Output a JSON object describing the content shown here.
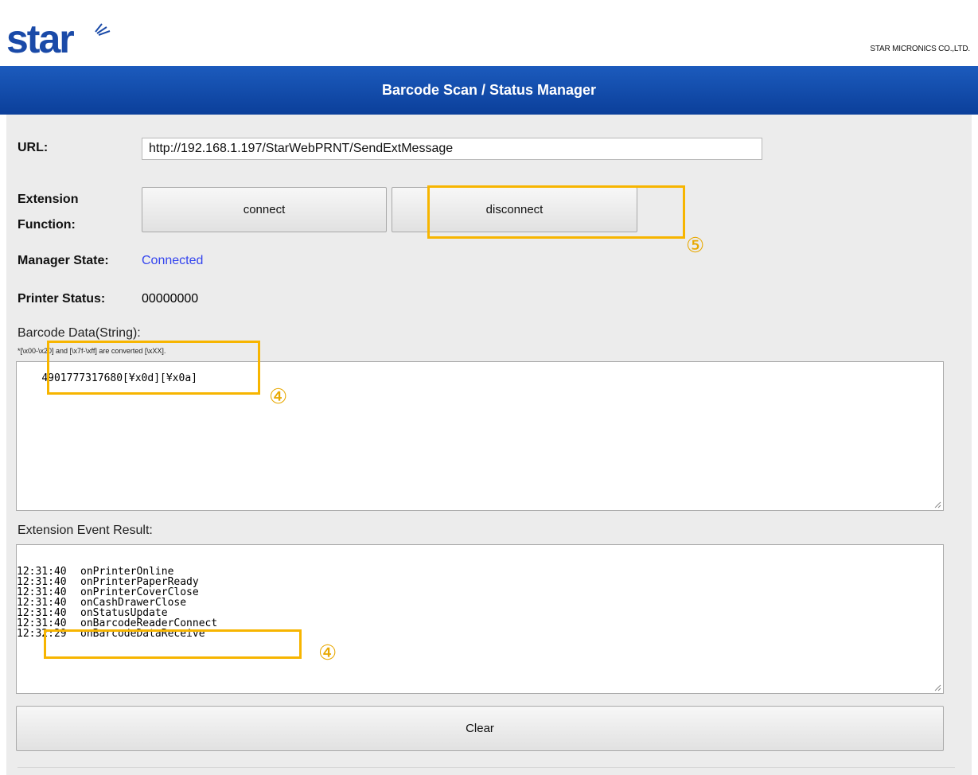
{
  "header": {
    "logo_alt": "star",
    "company": "STAR MICRONICS CO.,LTD."
  },
  "title": "Barcode Scan / Status Manager",
  "form": {
    "url_label": "URL:",
    "url_value": "http://192.168.1.197/StarWebPRNT/SendExtMessage",
    "extension_label_line1": "Extension",
    "extension_label_line2": "Function:",
    "connect_label": "connect",
    "disconnect_label": "disconnect",
    "manager_state_label": "Manager State:",
    "manager_state_value": "Connected",
    "printer_status_label": "Printer Status:",
    "printer_status_value": "00000000"
  },
  "barcode": {
    "label": "Barcode Data(String):",
    "note": "*[\\x00-\\x20] and [\\x7f-\\xff] are converted [\\xXX].",
    "data": "4901777317680[¥x0d][¥x0a]"
  },
  "events": {
    "label": "Extension Event Result:",
    "rows": [
      {
        "time": "12:31:40",
        "event": "onPrinterOnline"
      },
      {
        "time": "12:31:40",
        "event": "onPrinterPaperReady"
      },
      {
        "time": "12:31:40",
        "event": "onPrinterCoverClose"
      },
      {
        "time": "12:31:40",
        "event": "onCashDrawerClose"
      },
      {
        "time": "12:31:40",
        "event": "onStatusUpdate"
      },
      {
        "time": "12:31:40",
        "event": "onBarcodeReaderConnect"
      },
      {
        "time": "12:32:29",
        "event": "onBarcodeDataReceive"
      }
    ]
  },
  "clear_label": "Clear",
  "markers": {
    "disconnect": "⑤",
    "barcode": "④",
    "event": "④"
  },
  "colors": {
    "titlebar": "#0b3f9a",
    "state_connected": "#3344ee",
    "callout": "#f7b500",
    "logo": "#1a4aa8"
  }
}
